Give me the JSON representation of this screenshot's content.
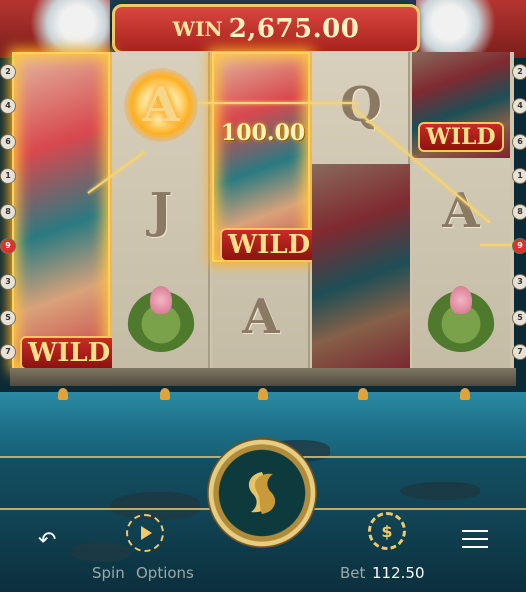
{
  "header": {
    "win_label": "WIN",
    "win_amount": "2,675.00"
  },
  "line_win": "100.00",
  "reels": [
    {
      "symbols": [
        "WILD"
      ]
    },
    {
      "symbols": [
        "A",
        "J",
        "lotus"
      ]
    },
    {
      "symbols": [
        "WILD",
        "A"
      ]
    },
    {
      "symbols": [
        "Q",
        "dragon"
      ]
    },
    {
      "symbols": [
        "WILD",
        "A",
        "lotus"
      ]
    }
  ],
  "wild_label": "WILD",
  "paylines_left": [
    "2",
    "4",
    "6",
    "1",
    "8",
    "9",
    "3",
    "5",
    "7"
  ],
  "paylines_right": [
    "2",
    "4",
    "6",
    "1",
    "8",
    "9",
    "3",
    "5",
    "7"
  ],
  "controls": {
    "spin_label": "Spin",
    "options_label": "Options",
    "bet_label": "Bet",
    "bet_value": "112.50"
  },
  "colors": {
    "banner": "#c0302a",
    "gold": "#f0c96b",
    "water": "#1b6e86"
  }
}
